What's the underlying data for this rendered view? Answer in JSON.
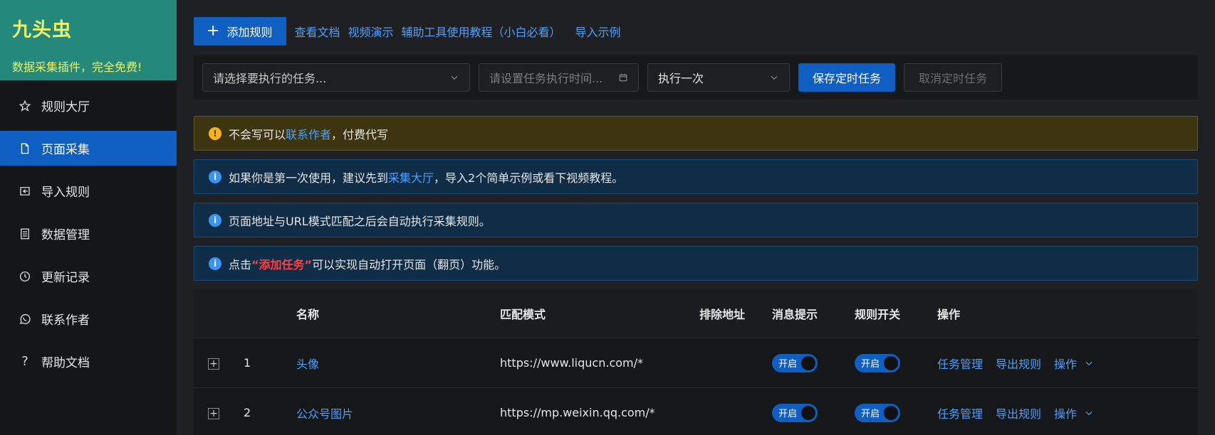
{
  "brand": {
    "title": "九头虫",
    "subtitle": "数据采集插件，完全免费!"
  },
  "sidebar": {
    "items": [
      {
        "label": "规则大厅",
        "icon": "star-icon"
      },
      {
        "label": "页面采集",
        "icon": "document-icon",
        "active": true
      },
      {
        "label": "导入规则",
        "icon": "import-icon"
      },
      {
        "label": "数据管理",
        "icon": "database-icon"
      },
      {
        "label": "更新记录",
        "icon": "history-icon"
      },
      {
        "label": "联系作者",
        "icon": "whatsapp-icon"
      },
      {
        "label": "帮助文档",
        "icon": "question-icon"
      }
    ]
  },
  "toolbar": {
    "add_rule": "添加规则",
    "links": [
      "查看文档",
      "视频演示",
      "辅助工具使用教程（小白必看）",
      "导入示例"
    ]
  },
  "schedule": {
    "task_placeholder": "请选择要执行的任务...",
    "time_placeholder": "请设置任务执行时间...",
    "frequency": "执行一次",
    "save": "保存定时任务",
    "cancel": "取消定时任务"
  },
  "alerts": {
    "warn": {
      "pre": "不会写可以",
      "link": "联系作者",
      "post": "，付费代写"
    },
    "info1": {
      "pre": "如果你是第一次使用，建议先到",
      "link": "采集大厅",
      "post": "，导入2个简单示例或看下视频教程。"
    },
    "info2": {
      "text": "页面地址与URL模式匹配之后会自动执行采集规则。"
    },
    "info3": {
      "pre": "点击",
      "red": "“添加任务”",
      "post": "可以实现自动打开页面（翻页）功能。"
    }
  },
  "table": {
    "headers": {
      "name": "名称",
      "pattern": "匹配模式",
      "exclude": "排除地址",
      "notify": "消息提示",
      "rule_switch": "规则开关",
      "ops": "操作"
    },
    "rows": [
      {
        "index": "1",
        "name": "头像",
        "pattern": "https://www.liqucn.com/*",
        "notify": "开启",
        "rule": "开启",
        "op1": "任务管理",
        "op2": "导出规则",
        "op3": "操作"
      },
      {
        "index": "2",
        "name": "公众号图片",
        "pattern": "https://mp.weixin.qq.com/*",
        "notify": "开启",
        "rule": "开启",
        "op1": "任务管理",
        "op2": "导出规则",
        "op3": "操作"
      }
    ]
  },
  "colors": {
    "brand_bg": "#24897a",
    "brand_text": "#e8f36b",
    "accent": "#0f5fc2",
    "link": "#4ba0ff"
  }
}
